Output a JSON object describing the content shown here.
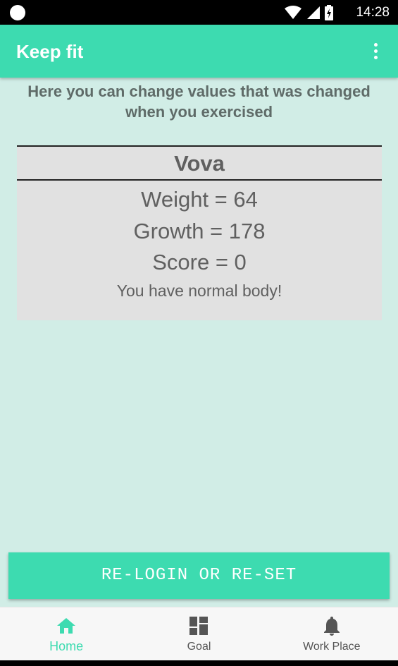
{
  "status_bar": {
    "time": "14:28"
  },
  "app_bar": {
    "title": "Keep fit",
    "menu_icon": "more-vert-icon"
  },
  "intro_text": "Here you can change values that was changed when you exercised",
  "profile": {
    "name": "Vova",
    "weight_text": "Weight = 64",
    "growth_text": "Growth = 178",
    "score_text": "Score = 0",
    "body_status": "You have normal body!"
  },
  "main_button": {
    "label": "RE-LOGIN OR RE-SET"
  },
  "bottom_nav": {
    "items": [
      {
        "label": "Home",
        "icon": "home-icon",
        "active": true
      },
      {
        "label": "Goal",
        "icon": "dashboard-icon",
        "active": false
      },
      {
        "label": "Work Place",
        "icon": "bell-icon",
        "active": false
      }
    ]
  },
  "colors": {
    "accent": "#3ddbb0",
    "background": "#d1ede6",
    "card": "#e1e1e1",
    "text_muted": "#606060"
  }
}
